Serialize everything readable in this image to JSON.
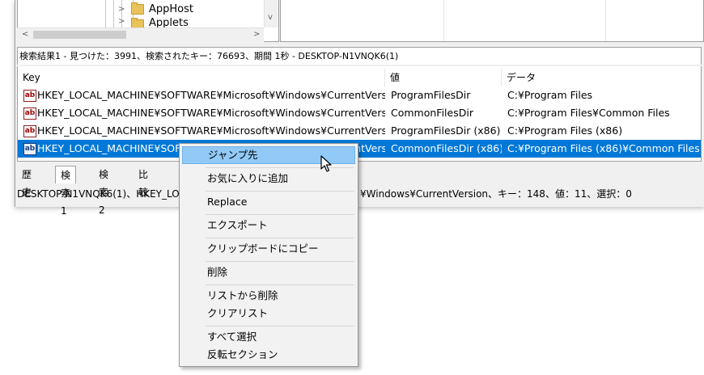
{
  "tree": {
    "items": [
      {
        "label": "AppHost",
        "chevron": ">"
      },
      {
        "label": "Applets",
        "chevron": ">"
      }
    ],
    "hscroll": {
      "left_arrow": "<",
      "right_arrow": ">"
    },
    "vscroll": {
      "down_arrow": "v"
    }
  },
  "status_top": "検索結果1 - 見つけた：3991、検索されたキー：76693、期間 1秒 - DESKTOP-N1VNQK6(1)",
  "list": {
    "columns": [
      "Key",
      "値",
      "データ"
    ],
    "rows": [
      {
        "icon": "ab",
        "key": "HKEY_LOCAL_MACHINE¥SOFTWARE¥Microsoft¥Windows¥CurrentVersion",
        "value": "ProgramFilesDir",
        "data": "C:¥Program Files",
        "selected": false
      },
      {
        "icon": "ab",
        "key": "HKEY_LOCAL_MACHINE¥SOFTWARE¥Microsoft¥Windows¥CurrentVersion",
        "value": "CommonFilesDir",
        "data": "C:¥Program Files¥Common Files",
        "selected": false
      },
      {
        "icon": "ab",
        "key": "HKEY_LOCAL_MACHINE¥SOFTWARE¥Microsoft¥Windows¥CurrentVersion",
        "value": "ProgramFilesDir (x86)",
        "data": "C:¥Program Files (x86)",
        "selected": false
      },
      {
        "icon": "ab",
        "key": "HKEY_LOCAL_MACHINE¥SOFTWARE¥Microsoft¥Windows¥CurrentVersion",
        "value": "CommonFilesDir (x86)",
        "data": "C:¥Program Files (x86)¥Common Files",
        "selected": true
      }
    ]
  },
  "tabs": [
    "歴史",
    "検索1",
    "検索2",
    "比較"
  ],
  "status_bottom": {
    "left": "DESKTOP-N1VNQK6(1)、HKEY_LO",
    "right": "¥Windows¥CurrentVersion、キー：148、値：11、選択：0"
  },
  "context_menu": {
    "items": [
      "ジャンプ先",
      "お気に入りに追加",
      "Replace",
      "エクスポート",
      "クリップボードにコピー",
      "削除",
      "リストから削除",
      "クリアリスト",
      "すべて選択",
      "反転セクション"
    ],
    "highlighted": "ジャンプ先"
  },
  "colors": {
    "selection": "#0078d7",
    "menu_highlight": "#91c9f7",
    "folder": "#e9c25a",
    "icon_red": "#a00000"
  }
}
